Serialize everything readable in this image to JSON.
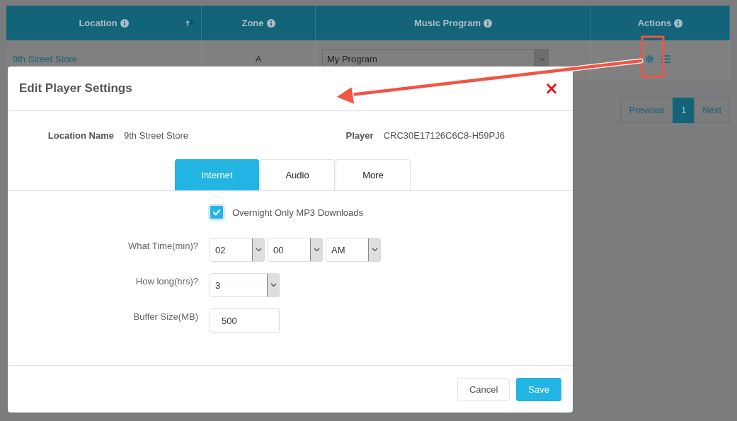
{
  "table": {
    "columns": [
      {
        "label": "Location",
        "sorted": true
      },
      {
        "label": "Zone",
        "sorted": false
      },
      {
        "label": "Music Program",
        "sorted": false
      },
      {
        "label": "Actions",
        "sorted": false
      }
    ],
    "rows": [
      {
        "location": "9th Street Store",
        "zone": "A",
        "music_program": "My Program"
      }
    ]
  },
  "pagination": {
    "previous": "Previous",
    "pages": [
      {
        "label": "1",
        "selected": true
      }
    ],
    "next": "Next"
  },
  "dialog": {
    "title": "Edit Player Settings",
    "close": "×",
    "info": [
      {
        "label": "Location Name",
        "value": "9th Street Store"
      },
      {
        "label": "Player",
        "value": "CRC30E17126C6C8-H59PJ6"
      }
    ],
    "tabs": [
      {
        "label": "Internet",
        "selected": true
      },
      {
        "label": "Audio",
        "selected": false
      },
      {
        "label": "More",
        "selected": false
      }
    ],
    "fields": [
      {
        "kind": "checkbox",
        "label": "Overnight Only MP3 Downloads",
        "checked": true
      },
      {
        "kind": "selects",
        "label": "What Time(min)?",
        "values": [
          "02",
          "00",
          "AM"
        ]
      },
      {
        "kind": "selects",
        "label": "How long(hrs)?",
        "values": [
          "3"
        ]
      },
      {
        "kind": "input",
        "label": "Buffer Size(MB)",
        "value": "500"
      }
    ],
    "buttons": [
      {
        "label": "Cancel",
        "kind": "default"
      },
      {
        "label": "Save",
        "kind": "primary"
      }
    ]
  }
}
